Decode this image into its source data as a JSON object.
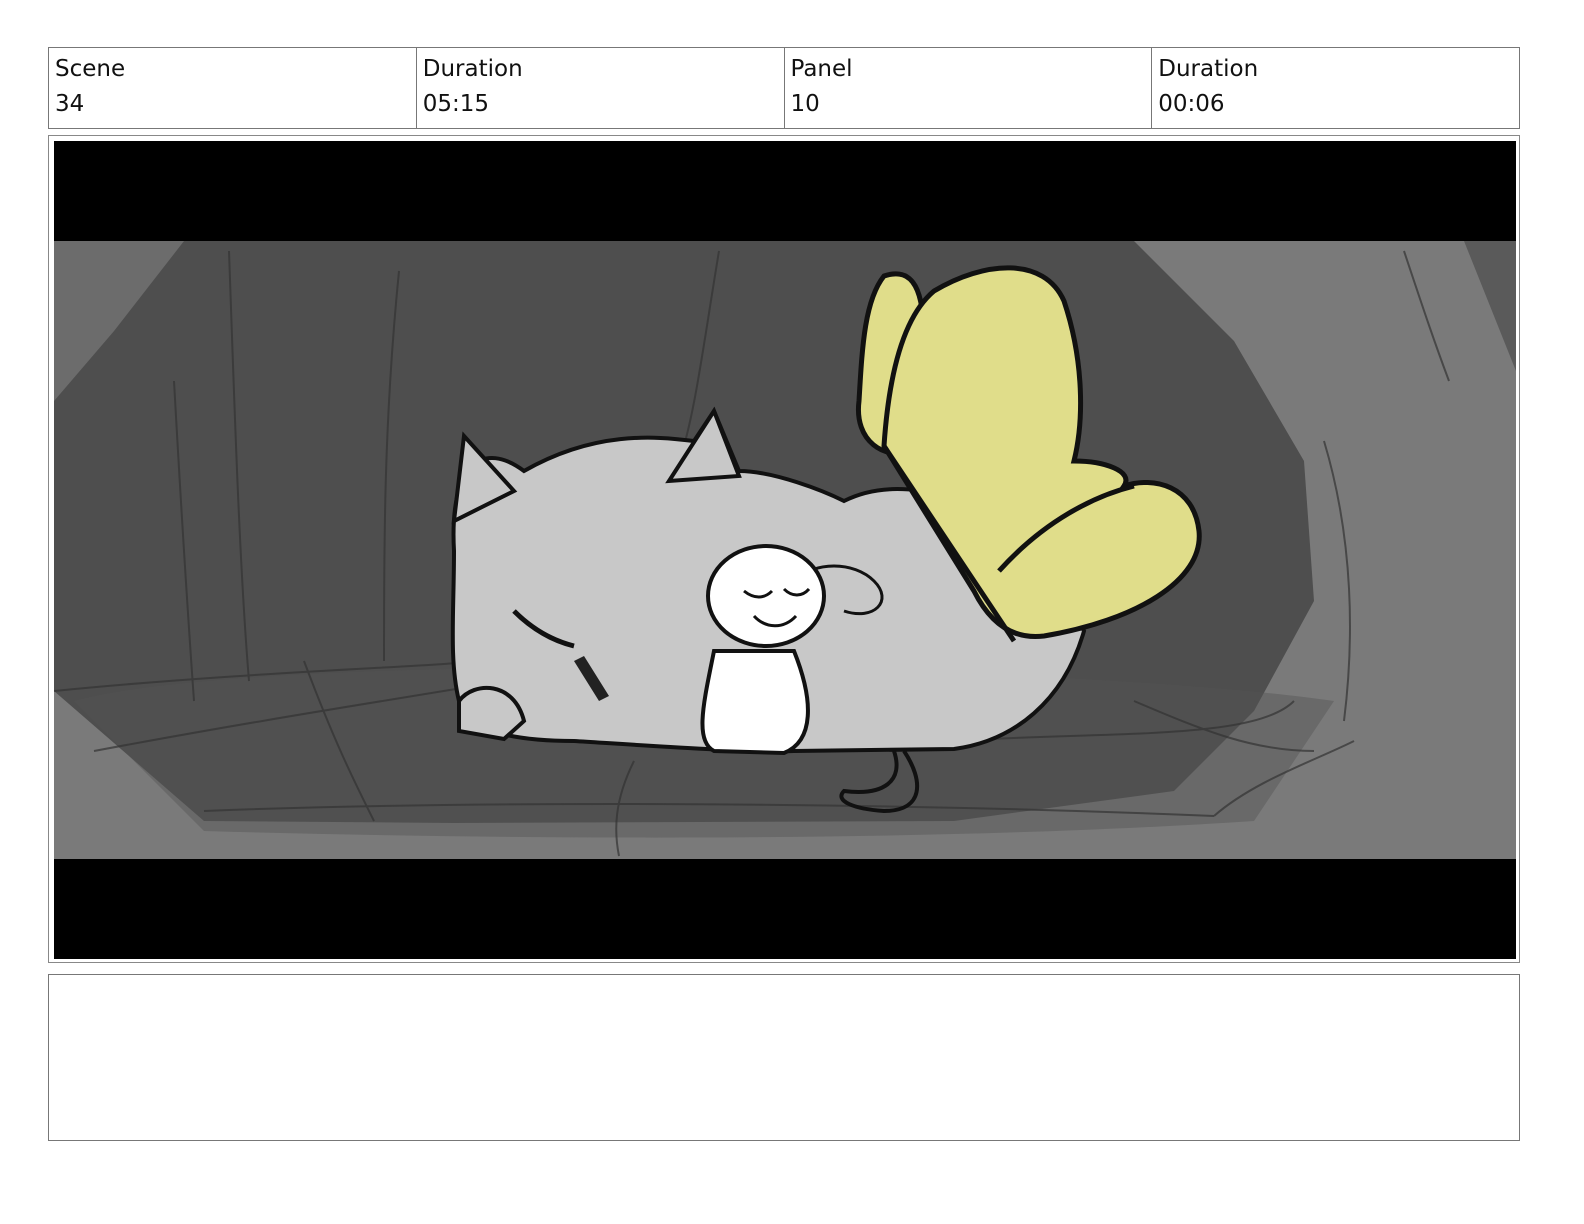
{
  "header": {
    "scene": {
      "label": "Scene",
      "value": "34"
    },
    "scene_duration": {
      "label": "Duration",
      "value": "05:15"
    },
    "panel": {
      "label": "Panel",
      "value": "10"
    },
    "panel_duration": {
      "label": "Duration",
      "value": "00:06"
    }
  },
  "notes": {
    "text": ""
  },
  "colors": {
    "letterbox": "#000000",
    "cave_light": "#7a7a7a",
    "cave_dark": "#4e4e4e",
    "fur": "#c8c8c8",
    "wing": "#e0dd8a"
  }
}
